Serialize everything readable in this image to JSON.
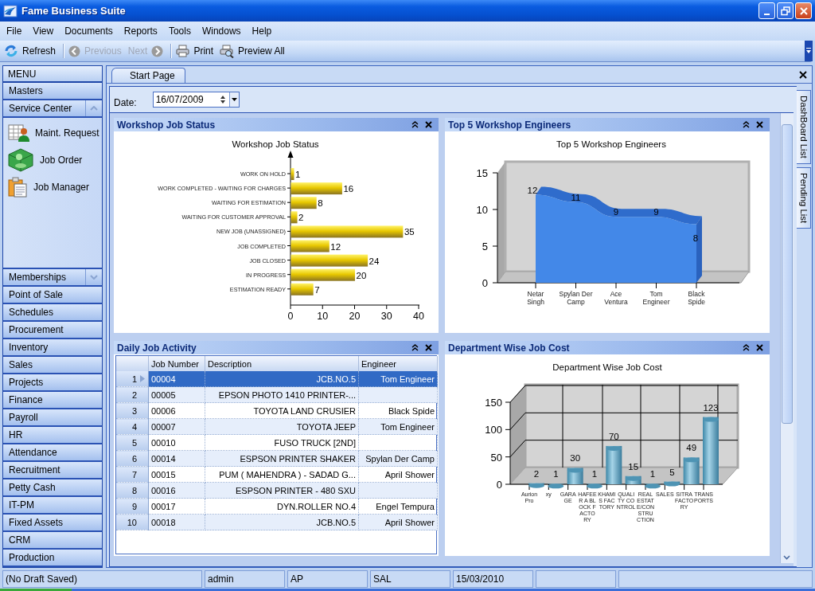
{
  "window": {
    "title": "Fame Business Suite"
  },
  "menu": [
    "File",
    "View",
    "Documents",
    "Reports",
    "Tools",
    "Windows",
    "Help"
  ],
  "toolbar": [
    {
      "label": "Refresh",
      "kind": "refresh",
      "disabled": false
    },
    {
      "label": "Previous",
      "kind": "previous",
      "disabled": true
    },
    {
      "label": "Next",
      "kind": "next",
      "disabled": true
    },
    {
      "label": "Print",
      "kind": "print",
      "disabled": false
    },
    {
      "label": "Preview All",
      "kind": "preview",
      "disabled": false
    }
  ],
  "sidebar": {
    "title": "MENU",
    "groups": [
      {
        "label": "Masters"
      },
      {
        "label": "Service Center",
        "expanded": true,
        "items": [
          {
            "label": "Maint. Request",
            "kind": "request"
          },
          {
            "label": "Job Order",
            "kind": "order"
          },
          {
            "label": "Job Manager",
            "kind": "manager"
          }
        ]
      },
      {
        "label": "Memberships",
        "expanded": false
      },
      {
        "label": "Point of Sale"
      },
      {
        "label": "Schedules"
      },
      {
        "label": "Procurement"
      },
      {
        "label": "Inventory"
      },
      {
        "label": "Sales"
      },
      {
        "label": "Projects"
      },
      {
        "label": "Finance"
      },
      {
        "label": "Payroll"
      },
      {
        "label": "HR"
      },
      {
        "label": "Attendance"
      },
      {
        "label": "Recruitment"
      },
      {
        "label": "Petty Cash"
      },
      {
        "label": "IT-PM"
      },
      {
        "label": "Fixed Assets"
      },
      {
        "label": "CRM"
      },
      {
        "label": "Production"
      }
    ]
  },
  "tabs": [
    {
      "label": "Start Page",
      "selected": true
    }
  ],
  "date": {
    "label": "Date:",
    "value": "16/07/2009"
  },
  "widgets": [
    {
      "title": "Workshop Job Status",
      "kind": "chart",
      "chart_data": {
        "type": "bar",
        "orientation": "horizontal",
        "title": "Workshop Job Status",
        "categories": [
          "WORK ON HOLD",
          "WORK COMPLETED - WAITING FOR CHARGES",
          "WAITING FOR ESTIMATION",
          "WAITING FOR CUSTOMER APPROVAL",
          "NEW JOB (UNASSIGNED)",
          "JOB COMPLETED",
          "JOB CLOSED",
          "IN PROGRESS",
          "ESTIMATION READY"
        ],
        "values": [
          1,
          16,
          8,
          2,
          35,
          12,
          24,
          20,
          7
        ],
        "xlim": [
          0,
          40
        ],
        "xticks": [
          0,
          10,
          20,
          30,
          40
        ],
        "data_labels": true
      }
    },
    {
      "title": "Top 5 Workshop Engineers",
      "kind": "chart",
      "chart_data": {
        "type": "area",
        "title": "Top 5 Workshop Engineers",
        "categories": [
          "Netar Singh",
          "Spylan Der Camp",
          "Ace Ventura",
          "Tom Engineer",
          "Black Spide"
        ],
        "values": [
          12,
          11,
          9,
          9,
          8
        ],
        "ylim": [
          0,
          15
        ],
        "yticks": [
          0,
          5,
          10,
          15
        ],
        "data_labels": true
      }
    },
    {
      "title": "Daily Job Activity",
      "kind": "table",
      "table": {
        "columns": [
          "Job Number",
          "Description",
          "Engineer"
        ],
        "rows": [
          {
            "number": "1",
            "job": "00004",
            "description": "JCB.NO.5",
            "engineer": "Tom Engineer",
            "selected": true
          },
          {
            "number": "2",
            "job": "00005",
            "description": "EPSON PHOTO 1410 PRINTER-...",
            "selected": false
          },
          {
            "number": "3",
            "job": "00006",
            "description": "TOYOTA LAND CRUSIER",
            "engineer": "Black Spide",
            "selected": false
          },
          {
            "number": "4",
            "job": "00007",
            "description": "TOYOTA JEEP",
            "engineer": "Tom Engineer",
            "selected": false
          },
          {
            "number": "5",
            "job": "00010",
            "description": "FUSO TRUCK [2ND]",
            "selected": false
          },
          {
            "number": "6",
            "job": "00014",
            "description": "ESPSON PRINTER  SHAKER",
            "engineer": "Spylan Der Camp",
            "selected": false
          },
          {
            "number": "7",
            "job": "00015",
            "description": "PUM ( MAHENDRA ) - SADAD G...",
            "engineer": "April Shower",
            "selected": false
          },
          {
            "number": "8",
            "job": "00016",
            "description": "ESPSON PRINTER - 480 SXU",
            "selected": false
          },
          {
            "number": "9",
            "job": "00017",
            "description": "DYN.ROLLER NO.4",
            "engineer": "Engel Tempura",
            "selected": false
          },
          {
            "number": "10",
            "job": "00018",
            "description": "JCB.NO.5",
            "engineer": "April Shower",
            "selected": false
          }
        ]
      }
    },
    {
      "title": "Department Wise Job Cost",
      "kind": "chart",
      "chart_data": {
        "type": "bar",
        "orientation": "vertical",
        "title": "Department Wise Job Cost",
        "categories": [
          "Aurion Pro",
          "xy",
          "GARAGE",
          "HAFEER A BLOCK FACTORY",
          "KHAMIS FACTORY",
          "QUALITY CONTROL",
          "REAL ESTATE/CONSTRUCTION",
          "SALES",
          "SITRA FACTORY",
          "TRANSPORTS"
        ],
        "values": [
          2,
          1,
          30,
          1,
          70,
          15,
          1,
          5,
          49,
          123
        ],
        "ylim": [
          0,
          150
        ],
        "yticks": [
          0,
          50,
          100,
          150
        ],
        "data_labels": true
      }
    }
  ],
  "side_tabs": [
    "DashBoard List",
    "Pending List"
  ],
  "status_bar": [
    "(No Draft Saved)",
    "admin",
    "AP",
    "SAL",
    "15/03/2010"
  ]
}
